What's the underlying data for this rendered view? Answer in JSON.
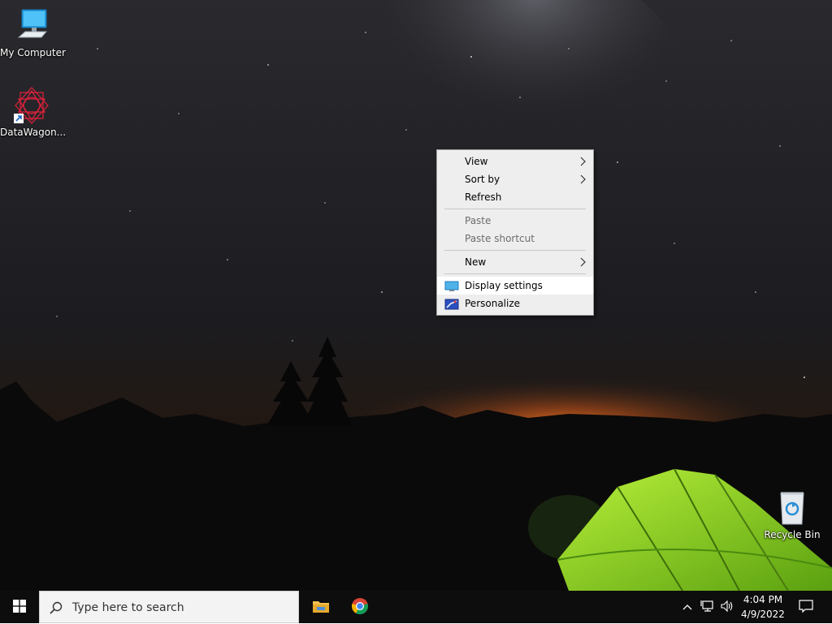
{
  "desktop": {
    "icons": [
      {
        "label": "My Computer",
        "icon": "computer-icon"
      },
      {
        "label": "DataWagon...",
        "icon": "datawagon-icon"
      },
      {
        "label": "Recycle Bin",
        "icon": "recycle-bin-icon"
      }
    ]
  },
  "context_menu": {
    "items": [
      {
        "label": "View",
        "submenu": true,
        "disabled": false
      },
      {
        "label": "Sort by",
        "submenu": true,
        "disabled": false
      },
      {
        "label": "Refresh",
        "submenu": false,
        "disabled": false
      },
      {
        "label": "Paste",
        "submenu": false,
        "disabled": true
      },
      {
        "label": "Paste shortcut",
        "submenu": false,
        "disabled": true
      },
      {
        "label": "New",
        "submenu": true,
        "disabled": false
      },
      {
        "label": "Display settings",
        "submenu": false,
        "disabled": false,
        "icon": "display-icon",
        "highlighted": true
      },
      {
        "label": "Personalize",
        "submenu": false,
        "disabled": false,
        "icon": "personalize-icon"
      }
    ]
  },
  "taskbar": {
    "search_placeholder": "Type here to search",
    "pinned": [
      {
        "name": "File Explorer",
        "icon": "folder-icon"
      },
      {
        "name": "Google Chrome",
        "icon": "chrome-icon"
      }
    ],
    "tray": {
      "time": "4:04 PM",
      "date": "4/9/2022"
    }
  },
  "colors": {
    "taskbar": "#0d0d0d",
    "menu_bg": "#eeeeee",
    "menu_hover": "#ffffff",
    "tent_green": "#7ed321"
  }
}
